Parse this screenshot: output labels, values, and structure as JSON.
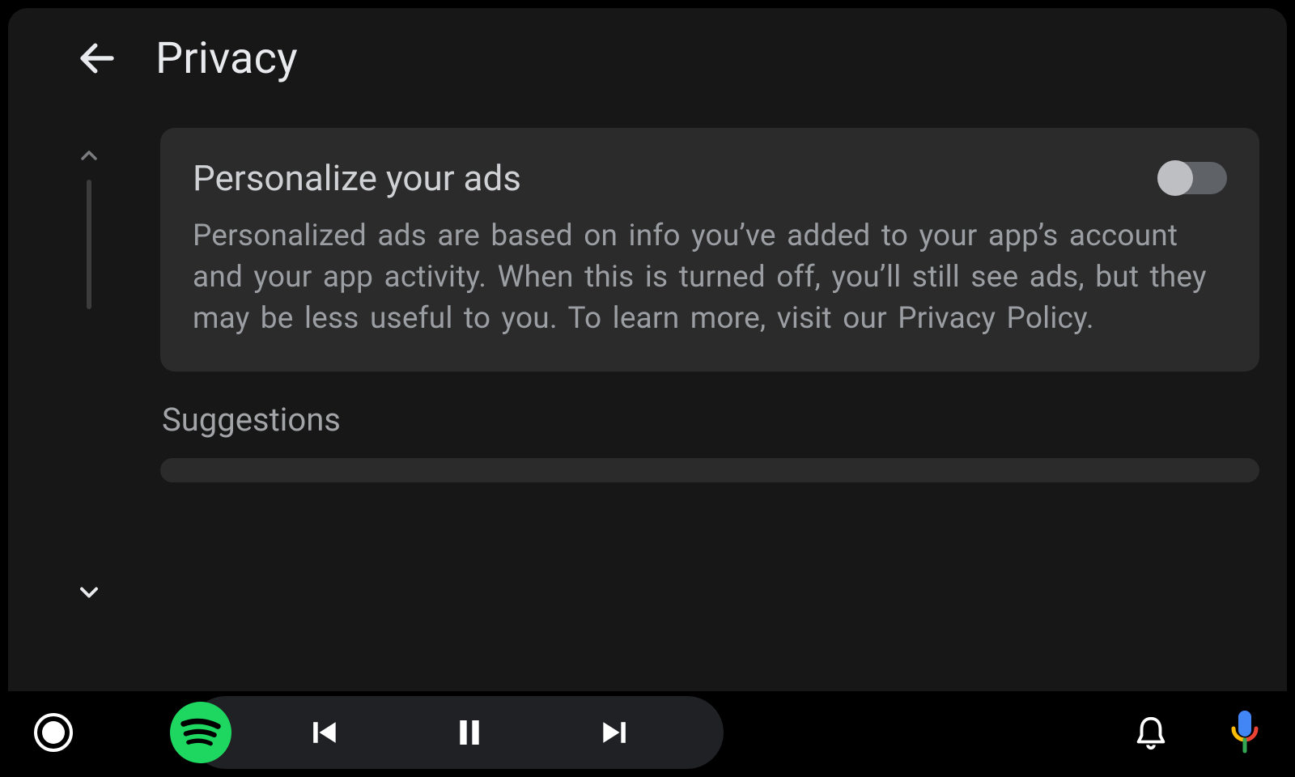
{
  "header": {
    "title": "Privacy",
    "back_icon": "arrow-back"
  },
  "scroll": {
    "up_icon": "chevron-up",
    "down_icon": "chevron-down"
  },
  "settings": {
    "items": [
      {
        "title": "Personalize your ads",
        "description": "Personalized ads are based on info you’ve added to your app’s account and your app activity. When this is turned off, you’ll still see ads, but they may be less useful to you. To learn more, visit our Privacy Policy.",
        "toggle_state": "off"
      }
    ],
    "section_label": "Suggestions"
  },
  "sysbar": {
    "home_icon": "circle-outline-record",
    "now_playing_app": "Spotify",
    "media": {
      "prev_icon": "skip-previous",
      "playpause_icon": "pause",
      "next_icon": "skip-next"
    },
    "notifications_icon": "bell",
    "assistant_icon": "google-mic"
  },
  "colors": {
    "bg": "#171717",
    "card": "#2b2b2b",
    "text_primary": "#e8eaed",
    "text_secondary": "#9b9ea3",
    "toggle_track": "#5f6368",
    "toggle_knob": "#bdbfc2",
    "spotify_green": "#1ED760"
  }
}
